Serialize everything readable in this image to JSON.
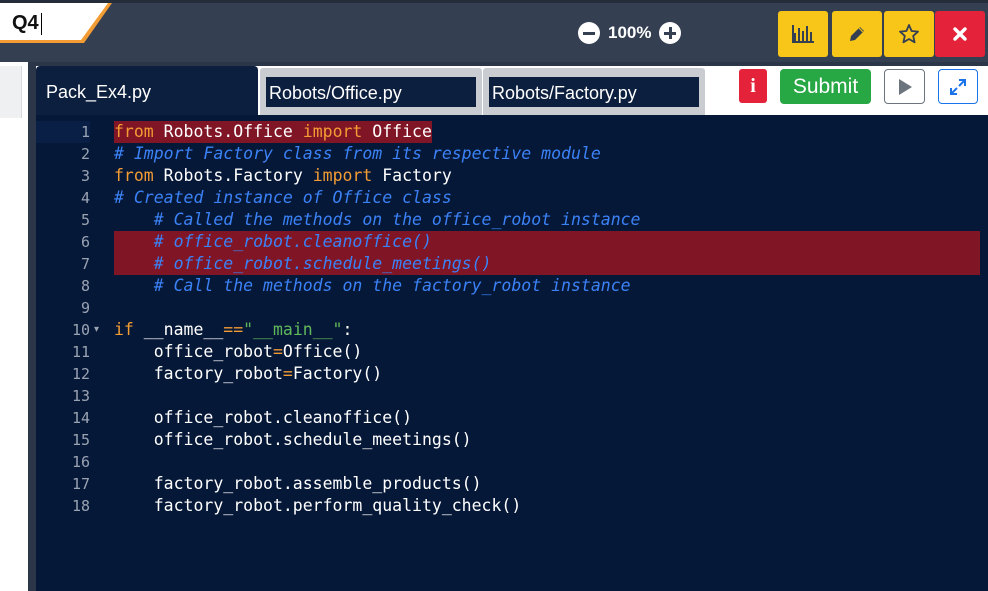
{
  "question": {
    "label": "Q4"
  },
  "zoom": {
    "value": "100%"
  },
  "toolbar": {
    "buttons": [
      "chart",
      "pencil",
      "star",
      "close"
    ]
  },
  "tabs": [
    {
      "label": "Pack_Ex4.py",
      "active": true
    },
    {
      "label": "Robots/Office.py",
      "active": false
    },
    {
      "label": "Robots/Factory.py",
      "active": false
    }
  ],
  "actions": {
    "info": "i",
    "submit": "Submit"
  },
  "colors": {
    "editor_bg": "#061838",
    "keyword": "#f39c34",
    "comment": "#3b82f6",
    "string": "#5fb85b",
    "highlight": "#801525",
    "submit": "#28a745"
  },
  "code_lines": [
    {
      "n": "1",
      "segs": [
        [
          "from",
          "kw"
        ],
        [
          " Robots.Office ",
          ""
        ],
        [
          "import",
          "kw"
        ],
        [
          " Office",
          ""
        ]
      ]
    },
    {
      "n": "2",
      "segs": [
        [
          "# Import Factory class from its respective module",
          "cm"
        ]
      ]
    },
    {
      "n": "3",
      "segs": [
        [
          "from",
          "kw"
        ],
        [
          " Robots.Factory ",
          ""
        ],
        [
          "import",
          "kw"
        ],
        [
          " Factory",
          ""
        ]
      ]
    },
    {
      "n": "4",
      "segs": [
        [
          "# Created instance of Office class",
          "cm"
        ]
      ]
    },
    {
      "n": "5",
      "segs": [
        [
          "    # Called the methods on the office_robot instance",
          "cm"
        ]
      ]
    },
    {
      "n": "6",
      "segs": [
        [
          "    # office_robot.cleanoffice()",
          "cm"
        ]
      ]
    },
    {
      "n": "7",
      "segs": [
        [
          "    # office_robot.schedule_meetings()",
          "cm"
        ]
      ]
    },
    {
      "n": "8",
      "segs": [
        [
          "    # Call the methods on the factory_robot instance",
          "cm"
        ]
      ]
    },
    {
      "n": "9",
      "segs": []
    },
    {
      "n": "10",
      "segs": [
        [
          "if",
          "kw"
        ],
        [
          " __name__",
          ""
        ],
        [
          "==",
          "op"
        ],
        [
          "\"__main__\"",
          "st"
        ],
        [
          ":",
          ""
        ]
      ]
    },
    {
      "n": "11",
      "segs": [
        [
          "    office_robot",
          ""
        ],
        [
          "=",
          "op"
        ],
        [
          "Office()",
          ""
        ]
      ]
    },
    {
      "n": "12",
      "segs": [
        [
          "    factory_robot",
          ""
        ],
        [
          "=",
          "op"
        ],
        [
          "Factory()",
          ""
        ]
      ]
    },
    {
      "n": "13",
      "segs": []
    },
    {
      "n": "14",
      "segs": [
        [
          "    office_robot.cleanoffice()",
          ""
        ]
      ]
    },
    {
      "n": "15",
      "segs": [
        [
          "    office_robot.schedule_meetings()",
          ""
        ]
      ]
    },
    {
      "n": "16",
      "segs": []
    },
    {
      "n": "17",
      "segs": [
        [
          "    factory_robot.assemble_products()",
          ""
        ]
      ]
    },
    {
      "n": "18",
      "segs": [
        [
          "    factory_robot.perform_quality_check()",
          ""
        ]
      ]
    }
  ]
}
